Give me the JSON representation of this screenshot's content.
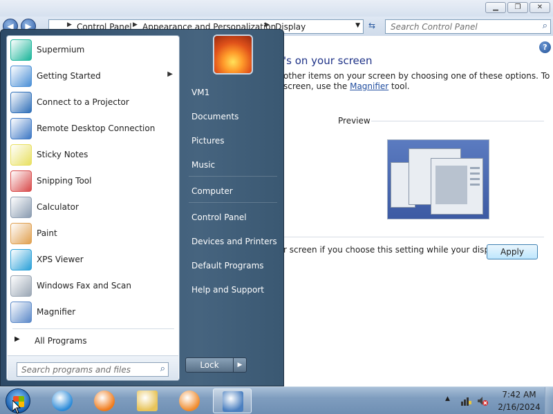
{
  "window": {
    "minimize_glyph": "▁",
    "maximize_glyph": "❐",
    "close_glyph": "✕",
    "back_glyph": "◀",
    "forward_glyph": "▶"
  },
  "address": {
    "breadcrumbs": [
      "Control Panel",
      "Appearance and Personalization",
      "Display"
    ],
    "separator": "▶",
    "dropdown_glyph": "▼",
    "refresh_glyph": "⇆"
  },
  "search": {
    "placeholder": "Search Control Panel",
    "icon_glyph": "⌕"
  },
  "help": {
    "glyph": "?"
  },
  "display": {
    "heading": "'s on your screen",
    "desc_line1": "other items on your screen by choosing one of these options. To",
    "desc_line2_prefix": "screen, use the ",
    "magnifier_link": "Magnifier",
    "desc_line2_suffix": " tool.",
    "preview_label": "Preview",
    "apply_text": "r screen if you choose this setting while your display is",
    "apply_button": "Apply"
  },
  "start_menu": {
    "programs": [
      {
        "label": "Supermium",
        "icon": "supermium-icon",
        "color": "#1bb59a",
        "arrow": ""
      },
      {
        "label": "Getting Started",
        "icon": "getting-started-icon",
        "color": "#4a8fd6",
        "arrow": "▶"
      },
      {
        "label": "Connect to a Projector",
        "icon": "projector-icon",
        "color": "#2f6fb8",
        "arrow": ""
      },
      {
        "label": "Remote Desktop Connection",
        "icon": "remote-desktop-icon",
        "color": "#3c77c4",
        "arrow": ""
      },
      {
        "label": "Sticky Notes",
        "icon": "sticky-notes-icon",
        "color": "#e8e060",
        "arrow": ""
      },
      {
        "label": "Snipping Tool",
        "icon": "snipping-tool-icon",
        "color": "#d84a4a",
        "arrow": ""
      },
      {
        "label": "Calculator",
        "icon": "calculator-icon",
        "color": "#8a9bb0",
        "arrow": ""
      },
      {
        "label": "Paint",
        "icon": "paint-icon",
        "color": "#e0a050",
        "arrow": ""
      },
      {
        "label": "XPS Viewer",
        "icon": "xps-viewer-icon",
        "color": "#2aa0d8",
        "arrow": ""
      },
      {
        "label": "Windows Fax and Scan",
        "icon": "fax-scan-icon",
        "color": "#9aa6b4",
        "arrow": ""
      },
      {
        "label": "Magnifier",
        "icon": "magnifier-icon",
        "color": "#5a88c8",
        "arrow": ""
      }
    ],
    "all_programs": "All Programs",
    "all_programs_arrow": "▶",
    "search_placeholder": "Search programs and files",
    "search_icon_glyph": "⌕",
    "right_items": [
      "VM1",
      "Documents",
      "Pictures",
      "Music",
      "Computer",
      "Control Panel",
      "Devices and Printers",
      "Default Programs",
      "Help and Support"
    ],
    "lock_button": "Lock",
    "lock_arrow": "▶"
  },
  "taskbar": {
    "apps": [
      {
        "name": "internet-explorer-icon",
        "color": "#2a8ad8"
      },
      {
        "name": "firefox-icon",
        "color": "#f07a1a"
      },
      {
        "name": "file-explorer-icon",
        "color": "#e8c45a"
      },
      {
        "name": "media-player-icon",
        "color": "#f08a2a"
      },
      {
        "name": "control-panel-icon",
        "color": "#4a7fc0"
      }
    ],
    "tray_arrow": "▲",
    "time": "7:42 AM",
    "date": "2/16/2024"
  }
}
